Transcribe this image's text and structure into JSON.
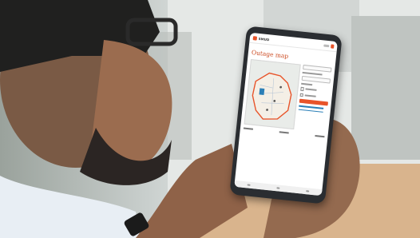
{
  "screen": {
    "logo": "SMUD",
    "title": "Outage map"
  }
}
